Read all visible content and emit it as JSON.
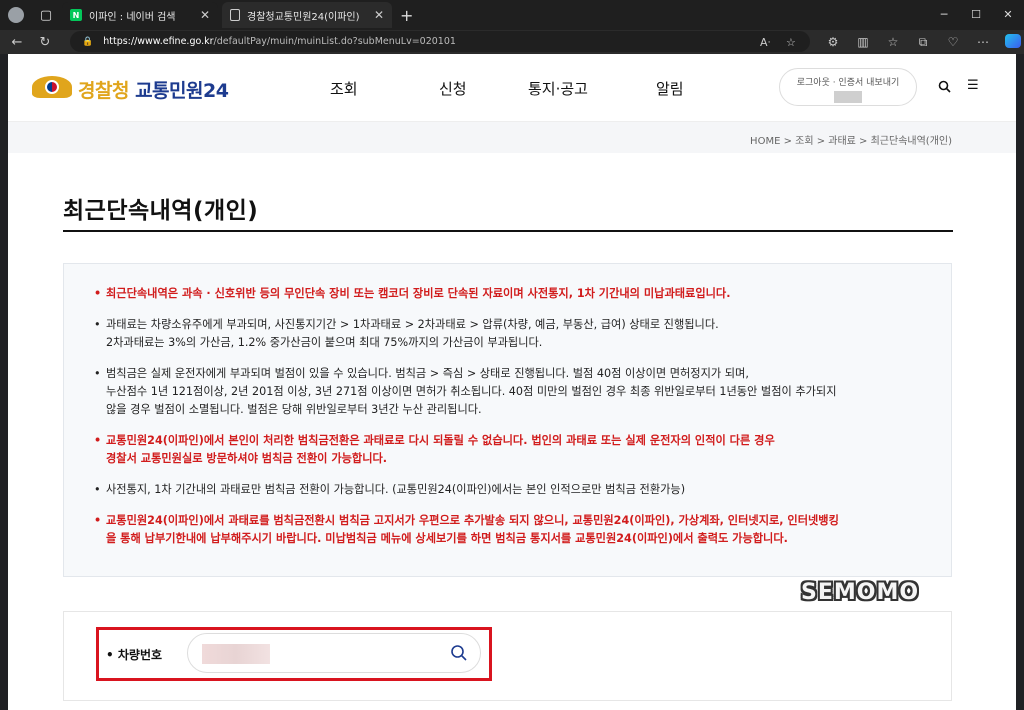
{
  "browser": {
    "tabs": [
      {
        "label": "이파인 : 네이버 검색",
        "favicon": "N"
      },
      {
        "label": "경찰청교통민원24(이파인)"
      }
    ],
    "url_host": "https://www.efine.go.kr",
    "url_path": "/defaultPay/muin/muinList.do?subMenuLv=020101"
  },
  "header": {
    "logo_part1": "경찰청",
    "logo_part2": "교통민원24",
    "nav": [
      "조회",
      "신청",
      "통지·공고",
      "알림"
    ],
    "login_text": "로그아웃 · 인증서 내보내기"
  },
  "breadcrumb": "HOME > 조회 > 과태료 > 최근단속내역(개인)",
  "page_title": "최근단속내역(개인)",
  "notices": [
    {
      "red": true,
      "lines": [
        "최근단속내역은 과속 · 신호위반 등의 무인단속 장비 또는 캠코더 장비로 단속된 자료이며 사전통지, 1차 기간내의 미납과태료입니다."
      ]
    },
    {
      "red": false,
      "lines": [
        "과태료는 차량소유주에게 부과되며, 사진통지기간 > 1차과태료 > 2차과태료 > 압류(차량, 예금, 부동산, 급여) 상태로 진행됩니다.",
        "2차과태료는 3%의 가산금, 1.2% 중가산금이 붙으며 최대 75%까지의 가산금이 부과됩니다."
      ]
    },
    {
      "red": false,
      "lines": [
        "범칙금은 실제 운전자에게 부과되며 벌점이 있을 수 있습니다. 범칙금 > 즉심 > 상태로 진행됩니다. 벌점 40점 이상이면 면허정지가 되며,",
        "누산점수 1년 121점이상, 2년 201점 이상, 3년 271점 이상이면 면허가 취소됩니다. 40점 미만의 벌점인 경우 최종 위반일로부터 1년동안 벌점이 추가되지",
        "않을 경우 벌점이 소멸됩니다. 벌점은 당해 위반일로부터 3년간 누산 관리됩니다."
      ]
    },
    {
      "red": true,
      "lines": [
        "교통민원24(이파인)에서 본인이 처리한 범칙금전환은 과태료로 다시 되돌릴 수 없습니다. 법인의 과태료 또는 실제 운전자의 인적이 다른 경우",
        "경찰서 교통민원실로 방문하셔야 범칙금 전환이 가능합니다."
      ]
    },
    {
      "red": false,
      "lines": [
        "사전통지, 1차 기간내의 과태료만 범칙금 전환이 가능합니다. (교통민원24(이파인)에서는 본인 인적으로만 범칙금 전환가능)"
      ]
    },
    {
      "red": true,
      "lines": [
        "교통민원24(이파인)에서 과태료를 범칙금전환시 범칙금 고지서가 우편으로 추가발송 되지 않으니, 교통민원24(이파인), 가상계좌, 인터넷지로, 인터넷뱅킹",
        "을 통해 납부기한내에 납부해주시기 바랍니다. 미납범칙금 메뉴에 상세보기를 하면 범칙금 통지서를 교통민원24(이파인)에서 출력도 가능합니다."
      ]
    }
  ],
  "watermark": "SEMOMO",
  "search": {
    "label": "차량번호"
  }
}
